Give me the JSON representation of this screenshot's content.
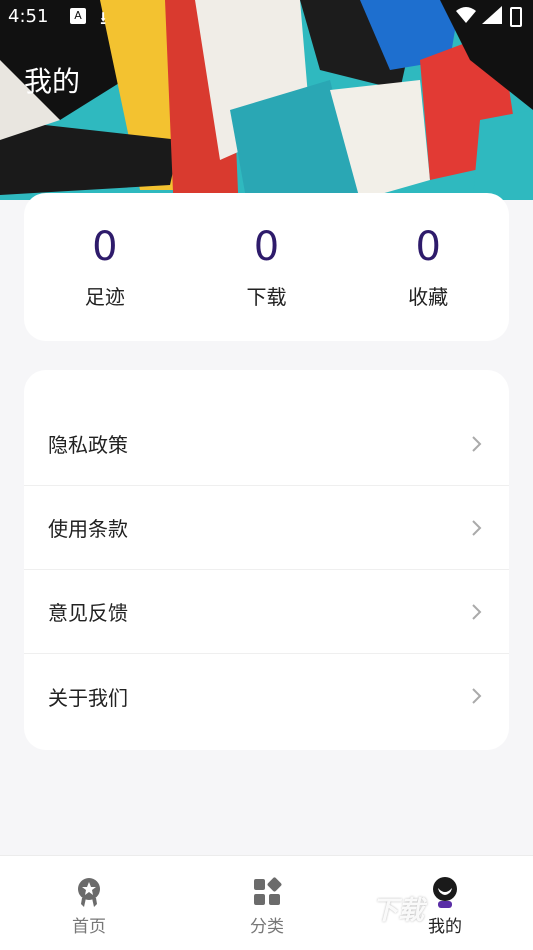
{
  "status_bar": {
    "time": "4:51",
    "a_icon": "A"
  },
  "header": {
    "title": "我的"
  },
  "stats": [
    {
      "value": "0",
      "label": "足迹"
    },
    {
      "value": "0",
      "label": "下载"
    },
    {
      "value": "0",
      "label": "收藏"
    }
  ],
  "menu": [
    {
      "label": "隐私政策"
    },
    {
      "label": "使用条款"
    },
    {
      "label": "意见反馈"
    },
    {
      "label": "关于我们"
    }
  ],
  "bottom_nav": [
    {
      "label": "首页",
      "icon": "badge-icon"
    },
    {
      "label": "分类",
      "icon": "grid-icon"
    },
    {
      "label": "我的",
      "icon": "profile-icon"
    }
  ],
  "colors": {
    "accent": "#2e1b6b",
    "nav_inactive": "#777777",
    "active_icon": "#5a2ea6"
  },
  "watermark": "下载"
}
